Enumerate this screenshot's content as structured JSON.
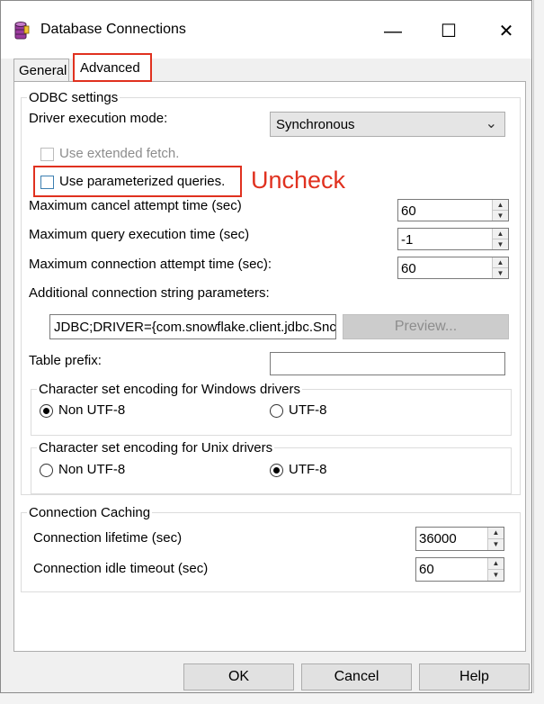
{
  "window": {
    "title": "Database Connections",
    "minimize_glyph": "—",
    "maximize_glyph": "☐",
    "close_glyph": "✕"
  },
  "tabs": {
    "general": "General",
    "advanced": "Advanced",
    "active": "Advanced"
  },
  "odbc": {
    "legend": "ODBC settings",
    "driver_mode_label": "Driver execution mode:",
    "driver_mode_value": "Synchronous",
    "extended_fetch_label": "Use extended fetch.",
    "extended_fetch_checked": false,
    "parameterized_label": "Use parameterized queries.",
    "parameterized_checked": false,
    "cancel_label": "Maximum cancel attempt time (sec)",
    "cancel_value": "60",
    "query_label": "Maximum query execution time (sec)",
    "query_value": "-1",
    "connect_label": "Maximum connection attempt time (sec):",
    "connect_value": "60",
    "additional_label": "Additional connection string parameters:",
    "additional_value": "JDBC;DRIVER={com.snowflake.client.jdbc.Snc",
    "preview_label": "Preview...",
    "table_prefix_label": "Table prefix:",
    "table_prefix_value": ""
  },
  "windows_encoding": {
    "legend": "Character set encoding for Windows drivers",
    "option_non_utf8": "Non UTF-8",
    "option_utf8": "UTF-8",
    "selected": "Non UTF-8"
  },
  "unix_encoding": {
    "legend": "Character set encoding for Unix drivers",
    "option_non_utf8": "Non UTF-8",
    "option_utf8": "UTF-8",
    "selected": "UTF-8"
  },
  "caching": {
    "legend": "Connection Caching",
    "lifetime_label": "Connection lifetime (sec)",
    "lifetime_value": "36000",
    "idle_label": "Connection idle timeout (sec)",
    "idle_value": "60"
  },
  "footer": {
    "ok": "OK",
    "cancel": "Cancel",
    "help": "Help"
  },
  "annotation": {
    "text": "Uncheck",
    "color": "#e0311f"
  }
}
